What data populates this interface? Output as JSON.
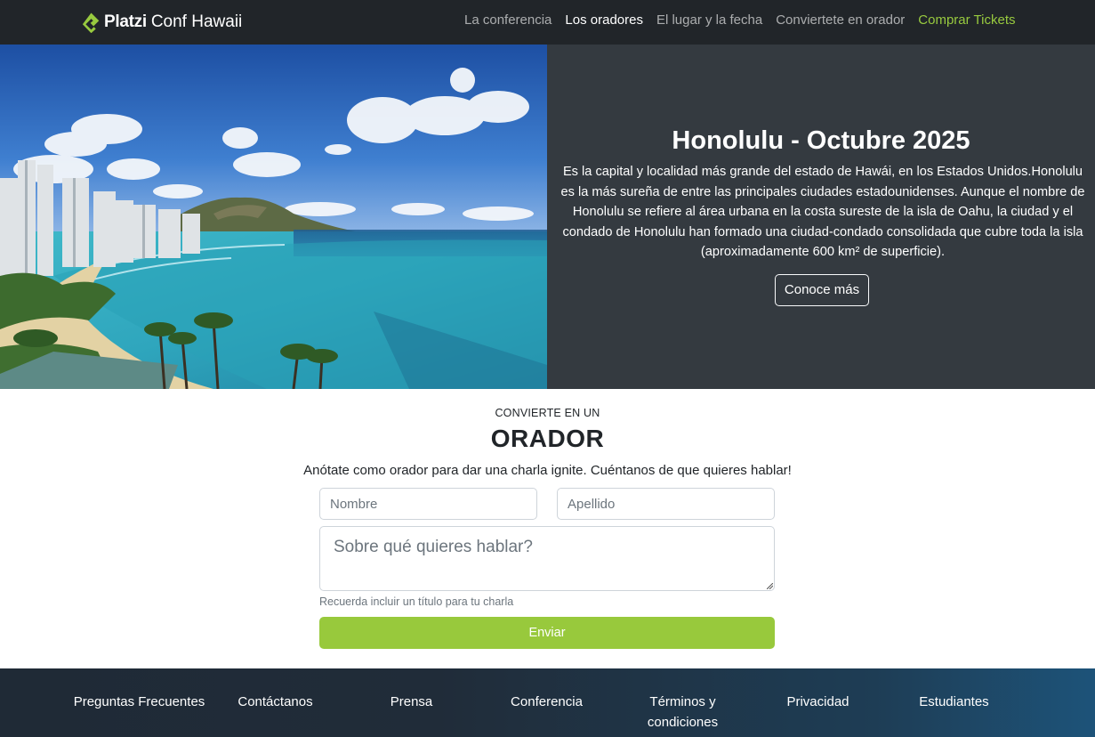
{
  "navbar": {
    "brand_bold": "Platzi",
    "brand_rest": "Conf Hawaii",
    "links": [
      {
        "label": "La conferencia"
      },
      {
        "label": "Los oradores"
      },
      {
        "label": "El lugar y la fecha"
      },
      {
        "label": "Conviertete en orador"
      },
      {
        "label": "Comprar Tickets"
      }
    ]
  },
  "hero": {
    "title": "Honolulu - Octubre 2025",
    "text": "Es la capital y localidad más grande del estado de Hawái, en los Estados Unidos.Honolulu es la más sureña de entre las principales ciudades estadounidenses. Aunque el nombre de Honolulu se refiere al área urbana en la costa sureste de la isla de Oahu, la ciudad y el condado de Honolulu han formado una ciudad-condado consolidada que cubre toda la isla (aproximadamente 600 km² de superficie).",
    "button_label": "Conoce más"
  },
  "speaker": {
    "kicker": "CONVIERTE EN UN",
    "title": "ORADOR",
    "description": "Anótate como orador para dar una charla ignite. Cuéntanos de que quieres hablar!",
    "first_name_placeholder": "Nombre",
    "last_name_placeholder": "Apellido",
    "topic_placeholder": "Sobre qué quieres hablar?",
    "help_text": "Recuerda incluir un título para tu charla",
    "submit_label": "Enviar"
  },
  "footer": {
    "links": [
      {
        "label": "Preguntas Frecuentes"
      },
      {
        "label": "Contáctanos"
      },
      {
        "label": "Prensa"
      },
      {
        "label": "Conferencia"
      },
      {
        "label": "Términos y condiciones"
      },
      {
        "label": "Privacidad"
      },
      {
        "label": "Estudiantes"
      }
    ]
  },
  "colors": {
    "navbar_bg": "#212529",
    "accent_green": "#98ca3f",
    "hero_info_bg": "#343a40",
    "submit_bg": "#98c93c",
    "footer_start": "#1f2a36",
    "footer_end": "#1d5379"
  }
}
